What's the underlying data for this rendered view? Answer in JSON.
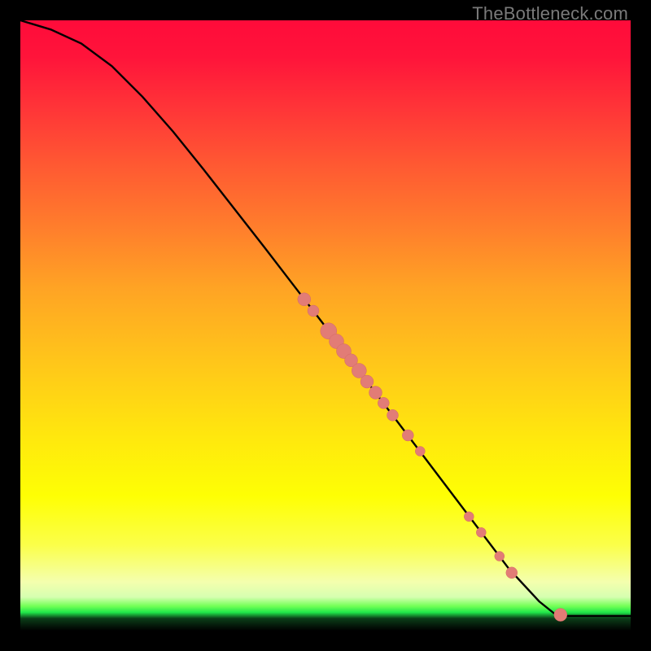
{
  "watermark": "TheBottleneck.com",
  "chart_data": {
    "type": "line",
    "title": "",
    "xlabel": "",
    "ylabel": "",
    "xlim": [
      0,
      100
    ],
    "ylim": [
      0,
      100
    ],
    "curve": [
      {
        "x": 0,
        "y": 100
      },
      {
        "x": 5,
        "y": 98.5
      },
      {
        "x": 10,
        "y": 96.2
      },
      {
        "x": 15,
        "y": 92.5
      },
      {
        "x": 20,
        "y": 87.5
      },
      {
        "x": 25,
        "y": 81.8
      },
      {
        "x": 30,
        "y": 75.6
      },
      {
        "x": 35,
        "y": 69.2
      },
      {
        "x": 40,
        "y": 62.8
      },
      {
        "x": 45,
        "y": 56.3
      },
      {
        "x": 50,
        "y": 49.8
      },
      {
        "x": 55,
        "y": 43.2
      },
      {
        "x": 60,
        "y": 36.6
      },
      {
        "x": 65,
        "y": 30.0
      },
      {
        "x": 70,
        "y": 23.4
      },
      {
        "x": 75,
        "y": 16.8
      },
      {
        "x": 80,
        "y": 10.2
      },
      {
        "x": 85,
        "y": 4.8
      },
      {
        "x": 88,
        "y": 2.4
      },
      {
        "x": 90,
        "y": 2.4
      },
      {
        "x": 95,
        "y": 2.4
      },
      {
        "x": 100,
        "y": 2.4
      }
    ],
    "series": [
      {
        "name": "points",
        "color": "#e27c76",
        "values": [
          {
            "x": 46.5,
            "y": 54.3,
            "r": 8
          },
          {
            "x": 48.0,
            "y": 52.4,
            "r": 7
          },
          {
            "x": 50.5,
            "y": 49.1,
            "r": 10
          },
          {
            "x": 51.8,
            "y": 47.4,
            "r": 9
          },
          {
            "x": 53.0,
            "y": 45.8,
            "r": 9
          },
          {
            "x": 54.2,
            "y": 44.3,
            "r": 8
          },
          {
            "x": 55.5,
            "y": 42.6,
            "r": 9
          },
          {
            "x": 56.8,
            "y": 40.8,
            "r": 8
          },
          {
            "x": 58.2,
            "y": 39.0,
            "r": 8
          },
          {
            "x": 59.5,
            "y": 37.3,
            "r": 7
          },
          {
            "x": 61.0,
            "y": 35.3,
            "r": 7
          },
          {
            "x": 63.5,
            "y": 32.0,
            "r": 7
          },
          {
            "x": 65.5,
            "y": 29.4,
            "r": 6
          },
          {
            "x": 73.5,
            "y": 18.7,
            "r": 6
          },
          {
            "x": 75.5,
            "y": 16.1,
            "r": 6
          },
          {
            "x": 78.5,
            "y": 12.2,
            "r": 6
          },
          {
            "x": 80.5,
            "y": 9.5,
            "r": 7
          },
          {
            "x": 88.5,
            "y": 2.6,
            "r": 8
          }
        ]
      }
    ]
  }
}
